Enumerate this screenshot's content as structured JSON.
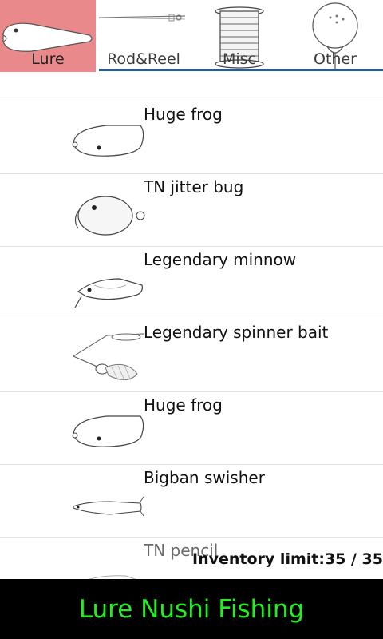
{
  "tabs": [
    {
      "label": "Lure",
      "icon": "lure-icon",
      "active": true
    },
    {
      "label": "Rod&Reel",
      "icon": "rod-reel-icon",
      "active": false
    },
    {
      "label": "Misc",
      "icon": "spool-icon",
      "active": false
    },
    {
      "label": "Other",
      "icon": "bobber-icon",
      "active": false
    }
  ],
  "items": [
    {
      "name": "Huge frog",
      "icon": "frog-lure-icon"
    },
    {
      "name": "TN jitter bug",
      "icon": "jitter-bug-lure-icon"
    },
    {
      "name": "Legendary minnow",
      "icon": "minnow-lure-icon"
    },
    {
      "name": "Legendary spinner bait",
      "icon": "spinner-bait-lure-icon"
    },
    {
      "name": "Huge frog",
      "icon": "frog-lure-icon"
    },
    {
      "name": "Bigban swisher",
      "icon": "swisher-lure-icon"
    },
    {
      "name": "TN pencil",
      "icon": "pencil-lure-icon"
    }
  ],
  "inventory": "Inventory limit:35 / 35",
  "footer": "Lure Nushi Fishing",
  "colors": {
    "active_tab": "#e9898b",
    "tab_underline": "#2d5a8c",
    "footer_text": "#22ee22",
    "footer_bg": "#000000"
  }
}
